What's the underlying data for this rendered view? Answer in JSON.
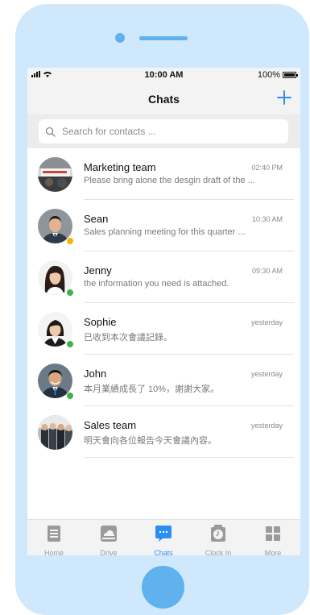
{
  "status_bar": {
    "time": "10:00 AM",
    "battery": "100%"
  },
  "header": {
    "title": "Chats",
    "add_icon": "plus-icon"
  },
  "search": {
    "placeholder": "Search for contacts ..."
  },
  "chats": [
    {
      "name": "Marketing team",
      "time": "02:40 PM",
      "preview": "Please bring alone the desgin draft of the ...",
      "avatar": "group-photo",
      "status": null
    },
    {
      "name": "Sean",
      "time": "10:30 AM",
      "preview": "Sales planning meeting for this quarter ...",
      "avatar": "man-photo",
      "status": "away"
    },
    {
      "name": "Jenny",
      "time": "09:30 AM",
      "preview": "the information you need is attached.",
      "avatar": "woman-photo",
      "status": "online"
    },
    {
      "name": "Sophie",
      "time": "yesterday",
      "preview": "已收到本次會議記錄。",
      "avatar": "woman-photo",
      "status": "online"
    },
    {
      "name": "John",
      "time": "yesterday",
      "preview": "本月業績成長了 10%，謝謝大家。",
      "avatar": "man-photo",
      "status": "online"
    },
    {
      "name": "Sales team",
      "time": "yesterday",
      "preview": "明天會向各位報告今天會議內容。",
      "avatar": "group-photo",
      "status": null
    }
  ],
  "tabs": [
    {
      "label": "Home",
      "icon": "home-icon",
      "active": false
    },
    {
      "label": "Drive",
      "icon": "cloud-drive-icon",
      "active": false
    },
    {
      "label": "Chats",
      "icon": "chat-bubble-icon",
      "active": true
    },
    {
      "label": "Clock In",
      "icon": "clock-icon",
      "active": false
    },
    {
      "label": "More",
      "icon": "grid-icon",
      "active": false
    }
  ],
  "colors": {
    "accent": "#2b8ef0",
    "online": "#3bb54a",
    "away": "#f5b400",
    "device": "#cfe8fb",
    "device_accent": "#5fb2ee"
  }
}
